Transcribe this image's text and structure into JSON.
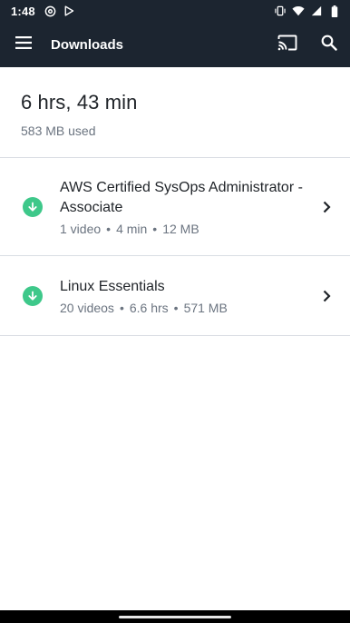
{
  "status_bar": {
    "time": "1:48"
  },
  "app_bar": {
    "title": "Downloads"
  },
  "summary": {
    "total_time": "6 hrs, 43 min",
    "used": "583 MB used"
  },
  "downloads": [
    {
      "title": "AWS Certified SysOps Administrator - Associate",
      "videos": "1 video",
      "duration": "4 min",
      "size": "12 MB"
    },
    {
      "title": "Linux Essentials",
      "videos": "20 videos",
      "duration": "6.6 hrs",
      "size": "571 MB"
    }
  ],
  "meta_separator": "•",
  "colors": {
    "bar_background": "#1c2530",
    "download_icon": "#3ec88a",
    "divider": "#d9dde3",
    "secondary_text": "#6b7480"
  }
}
